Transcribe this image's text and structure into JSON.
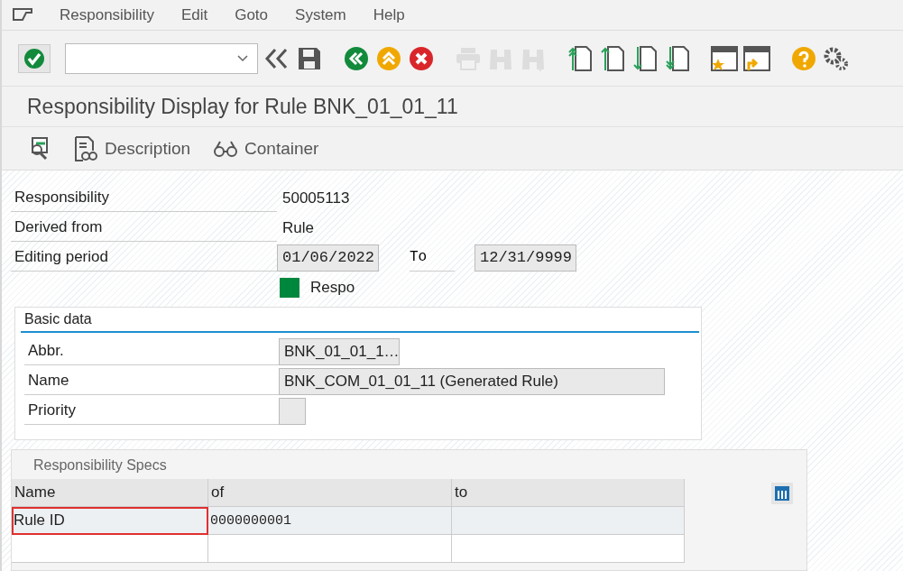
{
  "menu": [
    {
      "label": "Responsibility"
    },
    {
      "label": "Edit"
    },
    {
      "label": "Goto"
    },
    {
      "label": "System"
    },
    {
      "label": "Help"
    }
  ],
  "toolbar": [
    {
      "kind": "enter",
      "disabled": false
    },
    {
      "kind": "command"
    },
    {
      "kind": "collapse",
      "disabled": false
    },
    {
      "kind": "save",
      "disabled": false
    },
    {
      "kind": "gap"
    },
    {
      "kind": "back",
      "disabled": false
    },
    {
      "kind": "exit",
      "disabled": false
    },
    {
      "kind": "cancel",
      "disabled": false
    },
    {
      "kind": "gap"
    },
    {
      "kind": "print",
      "disabled": true
    },
    {
      "kind": "find",
      "disabled": true
    },
    {
      "kind": "find-next",
      "disabled": true
    },
    {
      "kind": "gap"
    },
    {
      "kind": "first-page",
      "disabled": false
    },
    {
      "kind": "prev-page",
      "disabled": false
    },
    {
      "kind": "next-page",
      "disabled": false
    },
    {
      "kind": "last-page",
      "disabled": false
    },
    {
      "kind": "gap"
    },
    {
      "kind": "new-window",
      "disabled": false
    },
    {
      "kind": "shortcut",
      "disabled": false
    },
    {
      "kind": "gap"
    },
    {
      "kind": "help",
      "disabled": false
    },
    {
      "kind": "settings",
      "disabled": false
    }
  ],
  "title": "Responsibility Display for Rule BNK_01_01_11",
  "app_toolbar": [
    {
      "kind": "details"
    },
    {
      "kind": "description",
      "label": "Description"
    },
    {
      "kind": "container",
      "label": "Container"
    }
  ],
  "fields": [
    {
      "label": "Responsibility",
      "value": "50005113",
      "kind": "text"
    },
    {
      "label": "Derived from",
      "value": "Rule",
      "kind": "text"
    },
    {
      "label": "Editing period",
      "value": "01/06/2022",
      "kind": "range",
      "to_label": "To",
      "to_value": "12/31/9999"
    }
  ],
  "status": {
    "label": "Respo",
    "color": "#00873e"
  },
  "basic_data": {
    "title": "Basic data",
    "fields": [
      {
        "label": "Abbr.",
        "value": "BNK_01_01_1…",
        "kind": "short"
      },
      {
        "label": "Name",
        "value": "BNK_COM_01_01_11 (Generated Rule)",
        "kind": "long"
      },
      {
        "label": "Priority",
        "kind": "tiny"
      }
    ]
  },
  "specs": {
    "title": "Responsibility Specs",
    "columns": [
      "Name",
      "of",
      "to"
    ],
    "rows": [
      {
        "name": "Rule ID",
        "of": "0000000001",
        "focused": true
      }
    ]
  }
}
